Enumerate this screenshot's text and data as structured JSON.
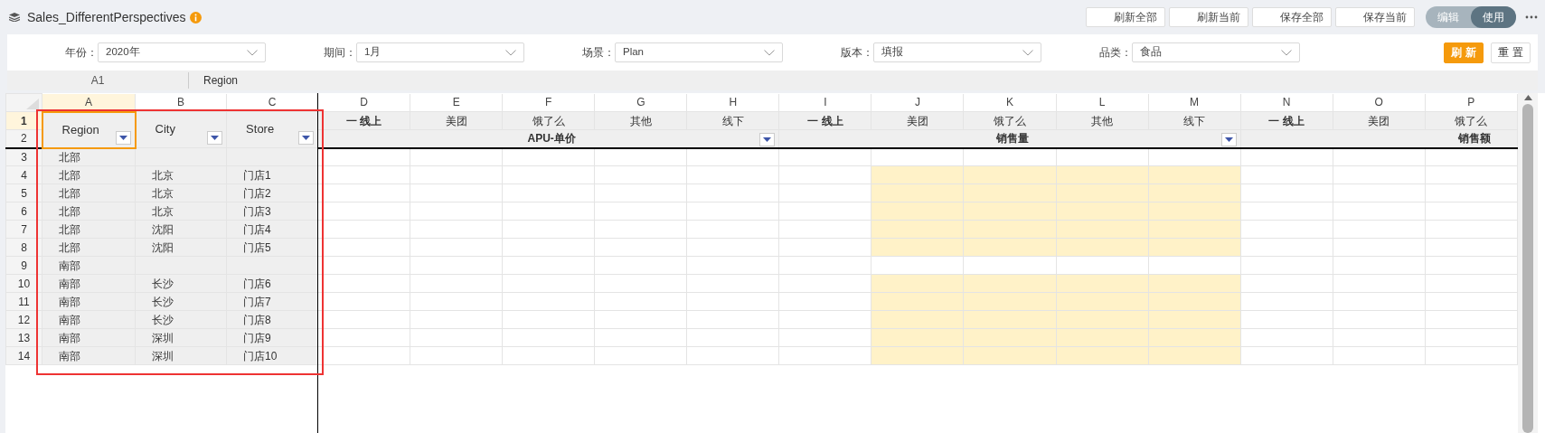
{
  "title": "Sales_DifferentPerspectives",
  "header_buttons": [
    "刷新全部",
    "刷新当前",
    "保存全部",
    "保存当前"
  ],
  "mode_toggle": [
    {
      "label": "编辑",
      "selected": false
    },
    {
      "label": "使用",
      "selected": true
    }
  ],
  "filters": [
    {
      "label": "年份：",
      "value": "2020年"
    },
    {
      "label": "期间：",
      "value": "1月"
    },
    {
      "label": "场景：",
      "value": "Plan"
    },
    {
      "label": "版本：",
      "value": "填报"
    },
    {
      "label": "品类：",
      "value": "食品"
    }
  ],
  "filter_buttons": [
    {
      "label": "刷 新",
      "kind": "primary"
    },
    {
      "label": "重 置",
      "kind": "secondary"
    }
  ],
  "name_box": "A1",
  "formula": "Region",
  "columns": [
    {
      "letter": "A",
      "selected": true
    },
    {
      "letter": "B",
      "selected": false
    },
    {
      "letter": "C",
      "selected": false
    },
    {
      "letter": "D",
      "selected": false
    },
    {
      "letter": "E",
      "selected": false
    },
    {
      "letter": "F",
      "selected": false
    },
    {
      "letter": "G",
      "selected": false
    },
    {
      "letter": "H",
      "selected": false
    },
    {
      "letter": "I",
      "selected": false
    },
    {
      "letter": "J",
      "selected": false
    },
    {
      "letter": "K",
      "selected": false
    },
    {
      "letter": "L",
      "selected": false
    },
    {
      "letter": "M",
      "selected": false
    },
    {
      "letter": "N",
      "selected": false
    },
    {
      "letter": "O",
      "selected": false
    },
    {
      "letter": "P",
      "selected": false
    }
  ],
  "header_rows": [
    {
      "number": "1",
      "selected": true
    },
    {
      "number": "2",
      "selected": false
    }
  ],
  "frozen_headers": [
    {
      "text": "Region",
      "active": true
    },
    {
      "text": "City",
      "active": false
    },
    {
      "text": "Store",
      "active": false
    }
  ],
  "measure_headers": [
    {
      "text": "一 线上",
      "kind": "parent",
      "highlighted": false,
      "group": {
        "label": "APU-单价",
        "filter": true
      }
    },
    {
      "text": "美团",
      "kind": "child",
      "highlighted": false
    },
    {
      "text": "饿了么",
      "kind": "child",
      "highlighted": false
    },
    {
      "text": "其他",
      "kind": "child",
      "highlighted": false
    },
    {
      "text": "线下",
      "kind": "child",
      "highlighted": false
    },
    {
      "text": "一 线上",
      "kind": "parent",
      "highlighted": false,
      "group": {
        "label": "销售量",
        "filter": true
      }
    },
    {
      "text": "美团",
      "kind": "child",
      "highlighted": true
    },
    {
      "text": "饿了么",
      "kind": "child",
      "highlighted": true
    },
    {
      "text": "其他",
      "kind": "child",
      "highlighted": true
    },
    {
      "text": "线下",
      "kind": "child",
      "highlighted": true
    },
    {
      "text": "一 线上",
      "kind": "parent",
      "highlighted": false,
      "group": {
        "label": "销售额",
        "filter": false
      }
    },
    {
      "text": "美团",
      "kind": "child",
      "highlighted": false
    },
    {
      "text": "饿了么",
      "kind": "child",
      "highlighted": false
    }
  ],
  "rows": [
    {
      "number": "3",
      "cells": [
        "北部"
      ],
      "highlighted": false
    },
    {
      "number": "4",
      "cells": [
        "北部",
        "北京",
        "门店1"
      ],
      "highlighted": true
    },
    {
      "number": "5",
      "cells": [
        "北部",
        "北京",
        "门店2"
      ],
      "highlighted": true
    },
    {
      "number": "6",
      "cells": [
        "北部",
        "北京",
        "门店3"
      ],
      "highlighted": true
    },
    {
      "number": "7",
      "cells": [
        "北部",
        "沈阳",
        "门店4"
      ],
      "highlighted": true
    },
    {
      "number": "8",
      "cells": [
        "北部",
        "沈阳",
        "门店5"
      ],
      "highlighted": true
    },
    {
      "number": "9",
      "cells": [
        "南部"
      ],
      "highlighted": false
    },
    {
      "number": "10",
      "cells": [
        "南部",
        "长沙",
        "门店6"
      ],
      "highlighted": true
    },
    {
      "number": "11",
      "cells": [
        "南部",
        "长沙",
        "门店7"
      ],
      "highlighted": true
    },
    {
      "number": "12",
      "cells": [
        "南部",
        "长沙",
        "门店8"
      ],
      "highlighted": true
    },
    {
      "number": "13",
      "cells": [
        "南部",
        "深圳",
        "门店9"
      ],
      "highlighted": true
    },
    {
      "number": "14",
      "cells": [
        "南部",
        "深圳",
        "门店10"
      ],
      "highlighted": true
    }
  ],
  "selection_frame": true
}
